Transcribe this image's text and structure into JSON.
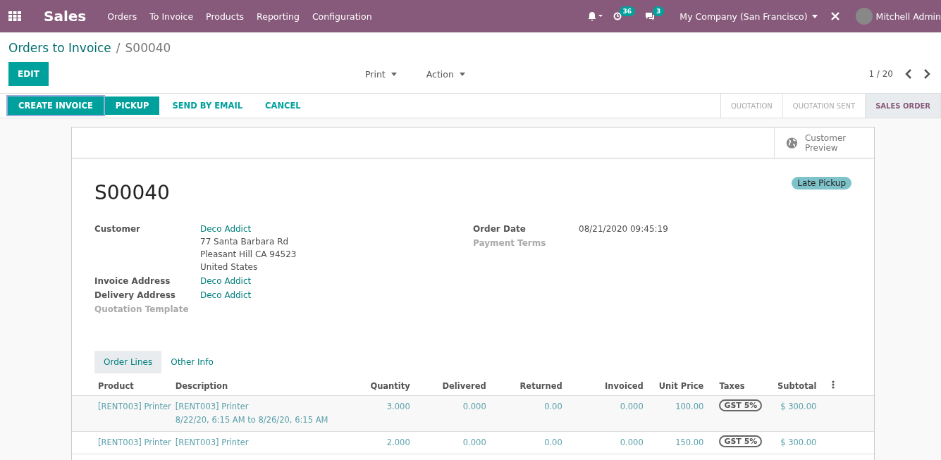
{
  "navbar": {
    "app_name": "Sales",
    "menu": [
      "Orders",
      "To Invoice",
      "Products",
      "Reporting",
      "Configuration"
    ],
    "activity_count": "36",
    "message_count": "3",
    "company": "My Company (San Francisco)",
    "user": "Mitchell Admin"
  },
  "breadcrumb": {
    "parent": "Orders to Invoice",
    "separator": "/",
    "current": "S00040"
  },
  "control_panel": {
    "edit_button": "EDIT",
    "dropdowns": [
      "Print",
      "Action"
    ],
    "pager": "1 / 20"
  },
  "actions": [
    {
      "label": "CREATE INVOICE",
      "kind": "primary"
    },
    {
      "label": "PICKUP",
      "kind": "primary"
    },
    {
      "label": "SEND BY EMAIL",
      "kind": "link"
    },
    {
      "label": "CANCEL",
      "kind": "link"
    }
  ],
  "stages": [
    {
      "label": "QUOTATION",
      "selected": false
    },
    {
      "label": "QUOTATION SENT",
      "selected": false
    },
    {
      "label": "SALES ORDER",
      "selected": true
    }
  ],
  "smart_button": {
    "label": "Customer Preview"
  },
  "record": {
    "title": "S00040",
    "tag": "Late Pickup"
  },
  "left_fields": [
    {
      "label": "Customer",
      "value": "Deco Addict",
      "address": [
        "77 Santa Barbara Rd",
        "Pleasant Hill CA 94523",
        "United States"
      ]
    },
    {
      "label": "Invoice Address",
      "value": "Deco Addict"
    },
    {
      "label": "Delivery Address",
      "value": "Deco Addict"
    },
    {
      "label": "Quotation Template"
    }
  ],
  "right_fields": [
    {
      "label": "Order Date",
      "value": "08/21/2020 09:45:19",
      "kind": "plain"
    },
    {
      "label": "Payment Terms"
    }
  ],
  "tabs": [
    {
      "label": "Order Lines",
      "selected": true
    },
    {
      "label": "Other Info",
      "selected": false
    }
  ],
  "table": {
    "columns": [
      {
        "label": "Product",
        "kind": "text"
      },
      {
        "label": "Description",
        "kind": "text"
      },
      {
        "label": "Quantity",
        "kind": "number"
      },
      {
        "label": "Delivered",
        "kind": "number"
      },
      {
        "label": "Returned",
        "kind": "number"
      },
      {
        "label": "Invoiced",
        "kind": "number"
      },
      {
        "label": "Unit Price",
        "kind": "number"
      },
      {
        "label": "Taxes",
        "kind": "tag"
      },
      {
        "label": "Subtotal",
        "kind": "number"
      }
    ],
    "rows": [
      {
        "cells": [
          [
            "[RENT003] Printer"
          ],
          [
            "[RENT003] Printer",
            "8/22/20, 6:15 AM to 8/26/20, 6:15 AM"
          ],
          [
            "3.000"
          ],
          [
            "0.000"
          ],
          [
            "0.00"
          ],
          [
            "0.000"
          ],
          [
            "100.00"
          ],
          [
            "GST 5%"
          ],
          [
            "$ 300.00"
          ]
        ]
      },
      {
        "cells": [
          [
            "[RENT003] Printer"
          ],
          [
            "[RENT003] Printer"
          ],
          [
            "2.000"
          ],
          [
            "0.000"
          ],
          [
            "0.00"
          ],
          [
            "0.000"
          ],
          [
            "150.00"
          ],
          [
            "GST 5%"
          ],
          [
            "$ 300.00"
          ]
        ]
      }
    ]
  }
}
